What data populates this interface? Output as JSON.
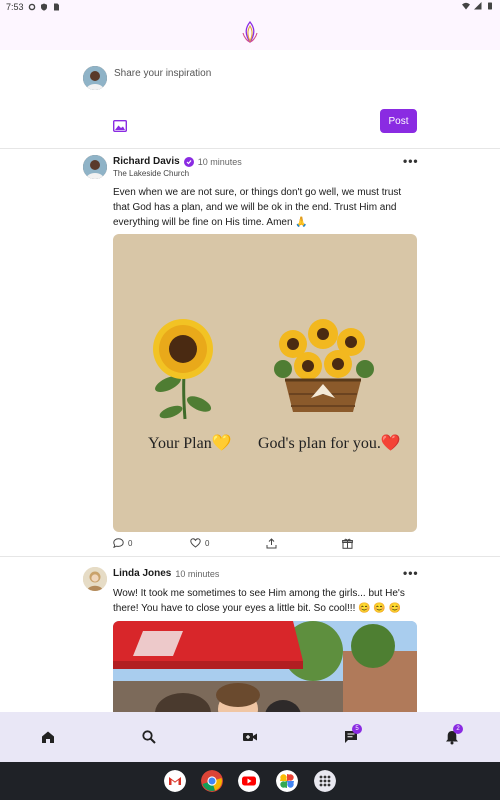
{
  "status_bar": {
    "time": "7:53"
  },
  "composer": {
    "placeholder": "Share your inspiration",
    "post_label": "Post"
  },
  "posts": [
    {
      "author": "Richard Davis",
      "time": "10 minutes",
      "verified": true,
      "org": "The Lakeside Church",
      "text": "Even when we are not sure, or things don't go well, we must trust that God has a plan, and we will be ok in the end. Trust Him and everything will be fine on His time. Amen 🙏",
      "image_captions": {
        "left": "Your Plan💛",
        "right": "God's plan for you.❤️"
      },
      "comments": "0",
      "likes": "0"
    },
    {
      "author": "Linda Jones",
      "time": "10 minutes",
      "text": "Wow! It took me sometimes to see Him among the girls... but He's there! You have to close your eyes a little bit. So cool!!! 😊 😊 😊"
    }
  ],
  "bottom_nav": {
    "messages_badge": "5",
    "notifications_badge": "2"
  },
  "colors": {
    "accent": "#8a2be2",
    "nav_bg": "#e9e7f6"
  },
  "icons": [
    "home-icon",
    "search-icon",
    "video-icon",
    "chat-icon",
    "bell-icon"
  ],
  "dock": [
    "gmail",
    "chrome",
    "youtube",
    "photos",
    "app-drawer"
  ]
}
